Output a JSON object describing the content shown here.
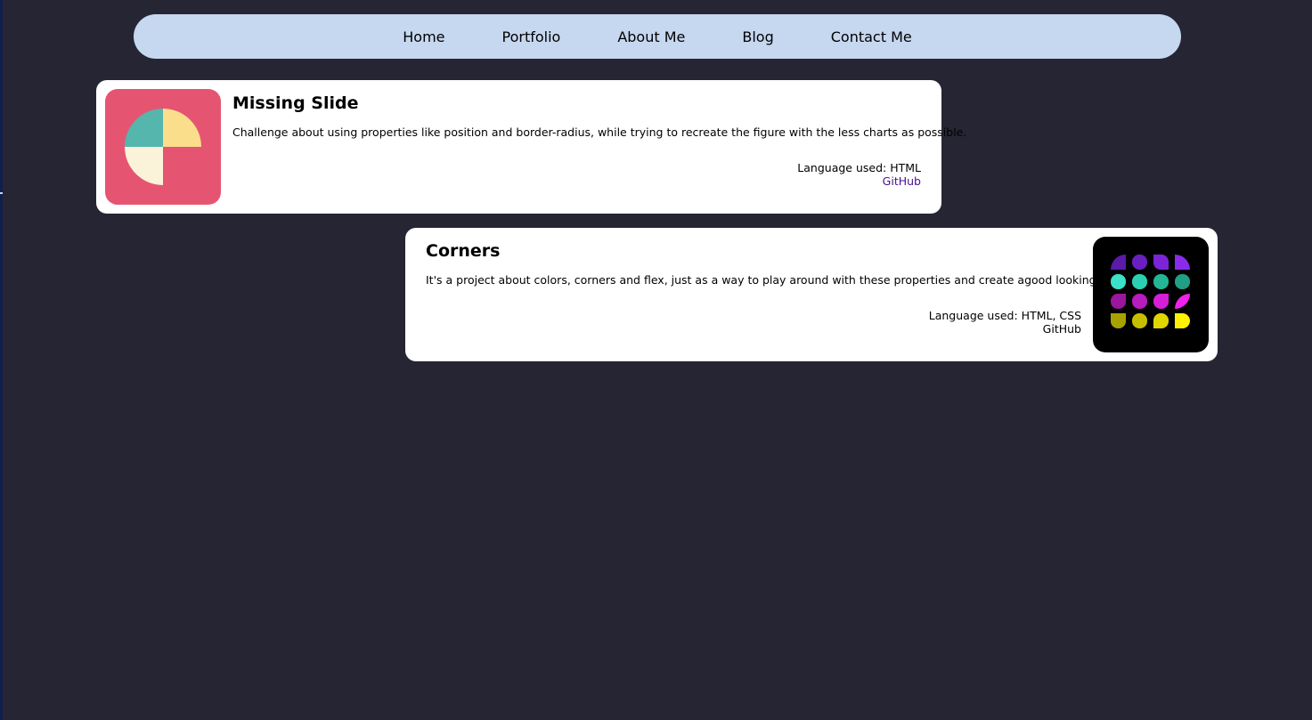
{
  "nav": {
    "items": [
      {
        "label": "Home"
      },
      {
        "label": "Portfolio"
      },
      {
        "label": "About Me"
      },
      {
        "label": "Blog"
      },
      {
        "label": "Contact Me"
      }
    ]
  },
  "projects": [
    {
      "title": "Missing Slide",
      "description": "Challenge about using properties like position and border-radius, while trying to recreate the figure with the less charts as possible.",
      "language": "Language used: HTML",
      "link_label": "GitHub",
      "thumbnail_colors": {
        "background": "#e55572",
        "teal": "#54b6ad",
        "yellow": "#fbde8c",
        "cream": "#faf3d9"
      }
    },
    {
      "title": "Corners",
      "description": "It's a project about colors, corners and flex, just as a way to play around with these properties and create agood looking grid.",
      "language": "Language used: HTML, CSS",
      "link_label": "GitHub",
      "thumbnail_colors": {
        "background": "#000000",
        "rows": [
          [
            "#5b1aa8",
            "#6a1fc0",
            "#7b24d8",
            "#8a2bea"
          ],
          [
            "#3ae0c7",
            "#2ccfaf",
            "#23b596",
            "#1f9f83"
          ],
          [
            "#9a169c",
            "#b81cbd",
            "#d41fd6",
            "#ee22ea"
          ],
          [
            "#a8a200",
            "#c8be00",
            "#e1d500",
            "#fff200"
          ]
        ]
      }
    }
  ],
  "colors": {
    "page_background": "#262533",
    "nav_background": "#c6d7f0",
    "card_background": "#ffffff",
    "visited_link": "#4b0f8f"
  }
}
